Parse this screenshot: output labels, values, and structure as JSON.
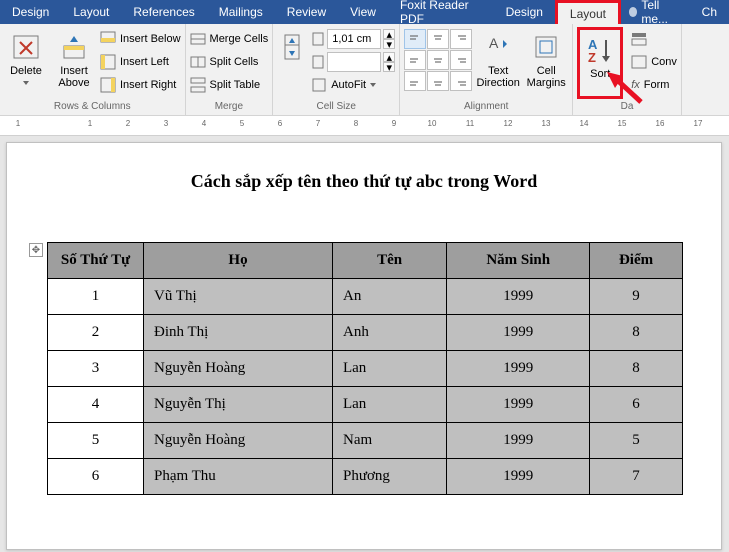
{
  "tabs": [
    "Design",
    "Layout",
    "References",
    "Mailings",
    "Review",
    "View",
    "Foxit Reader PDF",
    "Design",
    "Layout"
  ],
  "tellMe": "Tell me...",
  "extra": "Ch",
  "ribbon": {
    "delete": "Delete",
    "insertAbove": "Insert\nAbove",
    "insertBelow": "Insert Below",
    "insertLeft": "Insert Left",
    "insertRight": "Insert Right",
    "rowsCols": "Rows & Columns",
    "mergeCells": "Merge Cells",
    "splitCells": "Split Cells",
    "splitTable": "Split Table",
    "merge": "Merge",
    "heightVal": "1,01 cm",
    "autoFit": "AutoFit",
    "cellSize": "Cell Size",
    "textDirection": "Text\nDirection",
    "cellMargins": "Cell\nMargins",
    "alignment": "Alignment",
    "sort": "Sort",
    "conv": "Conv",
    "form": "Form",
    "data": "Da"
  },
  "rulerNumbers": [
    "1",
    "",
    "1",
    "2",
    "3",
    "4",
    "5",
    "6",
    "7",
    "8",
    "9",
    "10",
    "11",
    "12",
    "13",
    "14",
    "15",
    "16",
    "17"
  ],
  "doc": {
    "title": "Cách sắp xếp tên theo thứ tự abc trong Word",
    "headers": [
      "Số Thứ Tự",
      "Họ",
      "Tên",
      "Năm Sinh",
      "Điểm"
    ],
    "rows": [
      [
        "1",
        "Vũ Thị",
        "An",
        "1999",
        "9"
      ],
      [
        "2",
        "Đinh Thị",
        "Anh",
        "1999",
        "8"
      ],
      [
        "3",
        "Nguyễn Hoàng",
        "Lan",
        "1999",
        "8"
      ],
      [
        "4",
        "Nguyễn Thị",
        "Lan",
        "1999",
        "6"
      ],
      [
        "5",
        "Nguyễn Hoàng",
        "Nam",
        "1999",
        "5"
      ],
      [
        "6",
        "Phạm Thu",
        "Phương",
        "1999",
        "7"
      ]
    ]
  }
}
